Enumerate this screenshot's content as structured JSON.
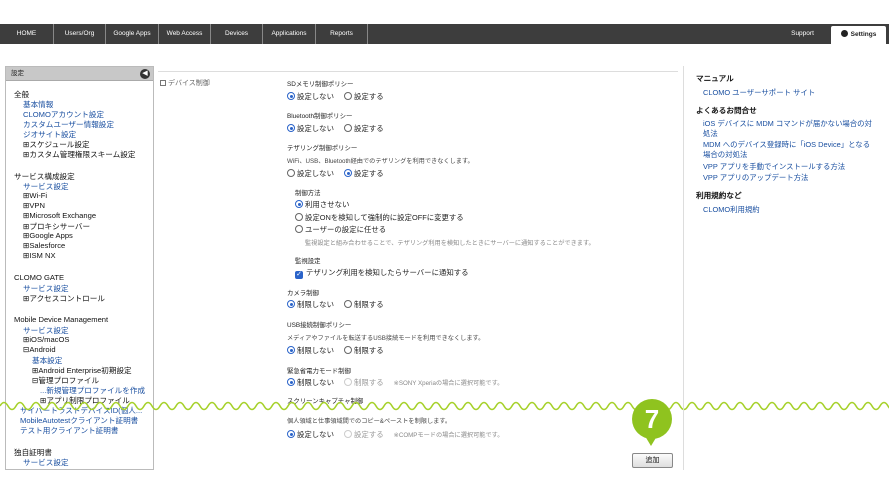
{
  "nav": {
    "tabs": [
      "HOME",
      "Users/Org",
      "Google Apps",
      "Web Access",
      "Devices",
      "Applications",
      "Reports"
    ],
    "support": "Support",
    "settings": "Settings"
  },
  "sidebar": {
    "header": "設定",
    "groups": [
      {
        "title": "全般",
        "items": [
          {
            "label": "基本情報",
            "kind": "link"
          },
          {
            "label": "CLOMOアカウント設定",
            "kind": "link"
          },
          {
            "label": "カスタムユーザー情報設定",
            "kind": "link"
          },
          {
            "label": "ジオサイト設定",
            "kind": "link"
          },
          {
            "label": "⊞スケジュール設定",
            "kind": "item"
          },
          {
            "label": "⊞カスタム管理権限スキーム設定",
            "kind": "item"
          }
        ]
      },
      {
        "title": "サービス構成設定",
        "items": [
          {
            "label": "サービス設定",
            "kind": "link"
          },
          {
            "label": "⊞Wi-Fi",
            "kind": "item"
          },
          {
            "label": "⊞VPN",
            "kind": "item"
          },
          {
            "label": "⊞Microsoft Exchange",
            "kind": "item"
          },
          {
            "label": "⊞プロキシサーバー",
            "kind": "item"
          },
          {
            "label": "⊞Google Apps",
            "kind": "item"
          },
          {
            "label": "⊞Salesforce",
            "kind": "item"
          },
          {
            "label": "⊞ISM NX",
            "kind": "item"
          }
        ]
      },
      {
        "title": "CLOMO GATE",
        "items": [
          {
            "label": "サービス設定",
            "kind": "link"
          },
          {
            "label": "⊞アクセスコントロール",
            "kind": "item"
          }
        ]
      },
      {
        "title": "Mobile Device Management",
        "items": [
          {
            "label": "サービス設定",
            "kind": "link"
          },
          {
            "label": "⊞iOS/macOS",
            "kind": "item"
          },
          {
            "label": "⊟Android",
            "kind": "item"
          },
          {
            "label": "基本設定",
            "kind": "link"
          },
          {
            "label": "⊞Android Enterprise初期設定",
            "kind": "item"
          },
          {
            "label": "⊟管理プロファイル",
            "kind": "item"
          },
          {
            "label": "...新規管理プロファイルを作成",
            "kind": "link"
          },
          {
            "label": "⊞アプリ制限プロファイル",
            "kind": "item"
          },
          {
            "label": "サイバートラストデバイスID(個人...",
            "kind": "link"
          },
          {
            "label": "MobileAutotestクライアント証明書",
            "kind": "link"
          },
          {
            "label": "テスト用クライアント証明書",
            "kind": "link"
          }
        ]
      },
      {
        "title": "独自証明書",
        "items": [
          {
            "label": "サービス設定",
            "kind": "link"
          }
        ]
      }
    ]
  },
  "main": {
    "section_label": "デバイス制御",
    "sd_title": "SDメモリ制御ポリシー",
    "sd_opt1": "設定しない",
    "sd_opt2": "設定する",
    "bt_title": "Bluetooth制御ポリシー",
    "bt_opt1": "設定しない",
    "bt_opt2": "設定する",
    "teth_title": "テザリング制御ポリシー",
    "teth_desc": "WiFi、USB、Bluetooth経由でのテザリングを利用できなくします。",
    "teth_opt1": "設定しない",
    "teth_opt2": "設定する",
    "method_title": "制御方法",
    "method_opt1": "利用させない",
    "method_opt2": "設定ONを検知して強制的に設定OFFに変更する",
    "method_opt3": "ユーザーの設定に任せる",
    "method_desc": "監視設定と組み合わせることで、テザリング利用を検知したときにサーバーに通知することができます。",
    "watch_title": "監視設定",
    "watch_check": "テザリング利用を検知したらサーバーに通知する",
    "cam_title": "カメラ制御",
    "cam_opt1": "制限しない",
    "cam_opt2": "制限する",
    "usb_title": "USB接続制御ポリシー",
    "usb_desc": "メディアやファイルを転送するUSB接続モードを利用できなくします。",
    "usb_opt1": "制限しない",
    "usb_opt2": "制限する",
    "emg_title": "緊急省電力モード制御",
    "emg_opt1": "制限しない",
    "emg_opt2": "制限する",
    "emg_note": "※SONY Xperiaの場合に選択可能です。",
    "scr_title": "スクリーンキャプチャ制御",
    "scr_desc": "個人領域と仕事領域間でのコピー&ペーストを制限します。",
    "scr_opt1": "設定しない",
    "scr_opt2": "設定する",
    "scr_note": "※COMPモードの場合に選択可能です。",
    "add_button": "追加"
  },
  "right": {
    "manual_title": "マニュアル",
    "manual_link": "CLOMO ユーザーサポート サイト",
    "faq_title": "よくあるお問合せ",
    "faq_links": [
      "iOS デバイスに MDM コマンドが届かない場合の対",
      "処法",
      "MDM へのデバイス登録時に「iOS Device」となる",
      "場合の対処法",
      "VPP アプリを手動でインストールする方法",
      "VPP アプリのアップデート方法"
    ],
    "terms_title": "利用規約など",
    "terms_link": "CLOMO利用規約"
  },
  "callout": {
    "number": "7"
  },
  "colors": {
    "accent": "#8fc31f",
    "link": "#1a4fa0",
    "topbar": "#3d3d3d"
  }
}
